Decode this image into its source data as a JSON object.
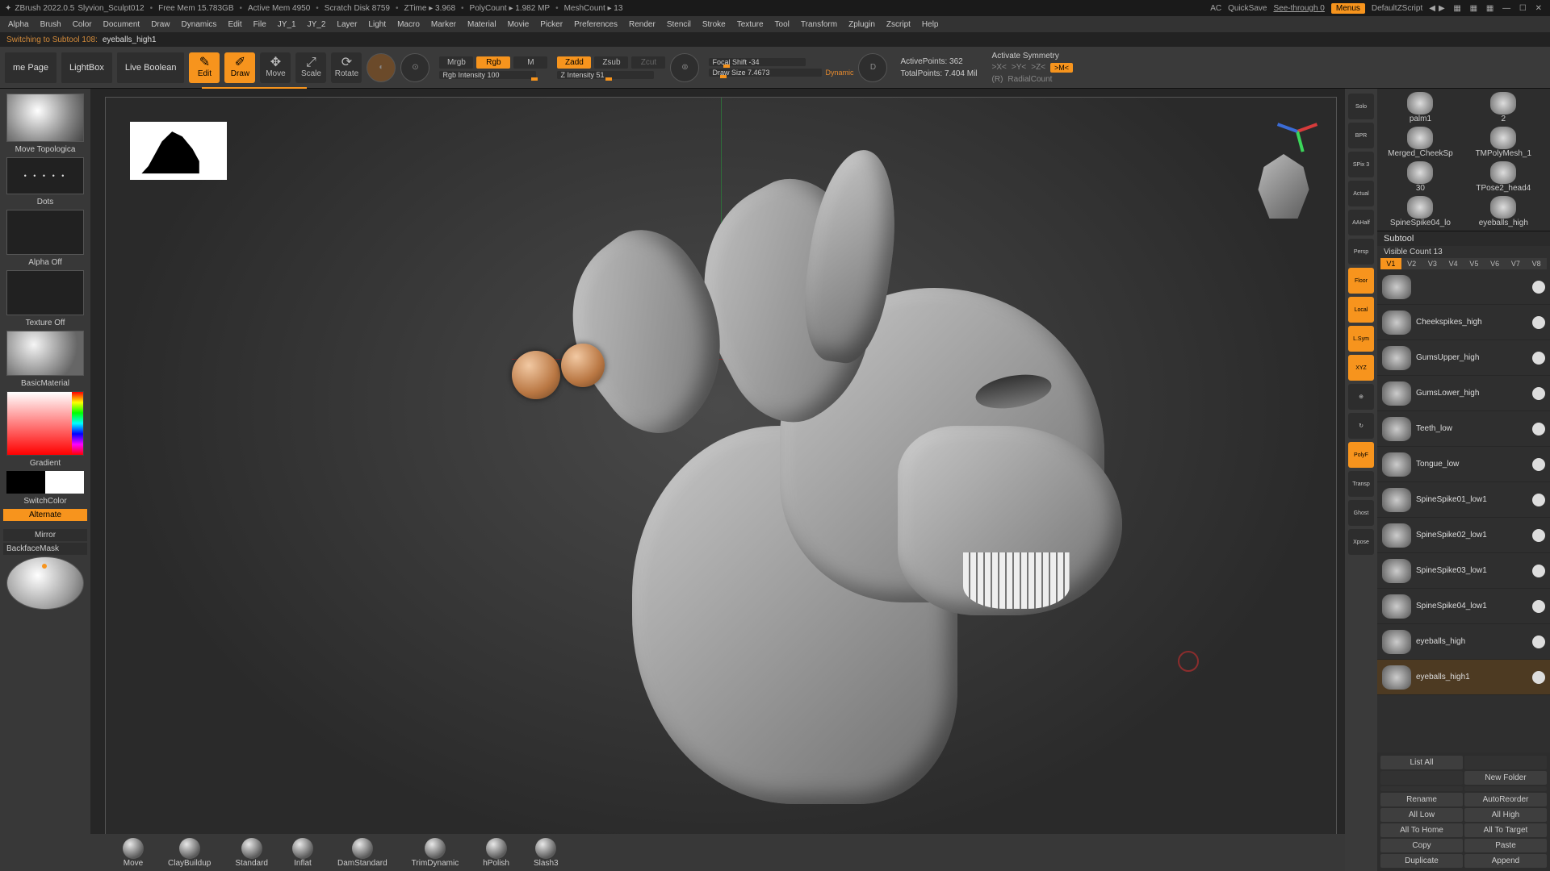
{
  "title": {
    "app": "ZBrush 2022.0.5",
    "project": "Slyvion_Sculpt012",
    "freemem": "Free Mem 15.783GB",
    "activemem": "Active Mem 4950",
    "scratch": "Scratch Disk 8759",
    "ztime": "ZTime ▸ 3.968",
    "polycount": "PolyCount ▸ 1.982 MP",
    "meshcount": "MeshCount ▸ 13",
    "ac": "AC",
    "quicksave": "QuickSave",
    "seethrough": "See-through  0",
    "menus": "Menus",
    "defaultz": "DefaultZScript"
  },
  "menubar": [
    "Alpha",
    "Brush",
    "Color",
    "Document",
    "Draw",
    "Dynamics",
    "Edit",
    "File",
    "JY_1",
    "JY_2",
    "Layer",
    "Light",
    "Macro",
    "Marker",
    "Material",
    "Movie",
    "Picker",
    "Preferences",
    "Render",
    "Stencil",
    "Stroke",
    "Texture",
    "Tool",
    "Transform",
    "Zplugin",
    "Zscript",
    "Help"
  ],
  "status": {
    "line": "Switching to Subtool 108:",
    "subtool": "eyeballs_high1"
  },
  "toolbar": {
    "home": "me Page",
    "lightbox": "LightBox",
    "liveboolean": "Live Boolean",
    "edit": "Edit",
    "draw": "Draw",
    "move": "Move",
    "scale": "Scale",
    "rotate": "Rotate",
    "mrgb": "Mrgb",
    "rgb": "Rgb",
    "m": "M",
    "rgbint": "Rgb Intensity 100",
    "zadd": "Zadd",
    "zsub": "Zsub",
    "zcut": "Zcut",
    "zint": "Z Intensity 51",
    "sculptris": "⊙",
    "focal": "Focal Shift -34",
    "drawsize": "Draw Size 7.4673",
    "dynamic": "Dynamic",
    "dcirc": "D",
    "activepts": "ActivePoints: 362",
    "totalpts": "TotalPoints: 7.404 Mil",
    "activesym": "Activate Symmetry",
    "symX": ">X<",
    "symY": ">Y<",
    "symZ": ">Z<",
    "symM": ">M<",
    "radial": "(R)",
    "radialcount": "RadialCount"
  },
  "left": {
    "brush": "Move Topologica",
    "dots": "Dots",
    "alphaoff": "Alpha Off",
    "textureoff": "Texture Off",
    "material": "BasicMaterial",
    "gradient": "Gradient",
    "switchcolor": "SwitchColor",
    "alternate": "Alternate",
    "mirror": "Mirror",
    "backface": "BackfaceMask"
  },
  "dock": [
    "Solo",
    "BPR",
    "SPix 3",
    "Actual",
    "AAHalf",
    "Persp",
    "Floor",
    "Local",
    "L.Sym",
    "XYZ",
    "⊕",
    "↻",
    "PolyF",
    "Transp",
    "Ghost",
    "Xpose"
  ],
  "dock_on": [
    6,
    7,
    8,
    9,
    12
  ],
  "tool_thumbs": [
    {
      "name": "palm1"
    },
    {
      "name": "2"
    },
    {
      "name": "Merged_CheekSp"
    },
    {
      "name": "TMPolyMesh_1"
    },
    {
      "name": "30"
    },
    {
      "name": "TPose2_head4"
    },
    {
      "name": "SpineSpike04_lo"
    },
    {
      "name": "eyeballs_high"
    }
  ],
  "subtool": {
    "head": "Subtool",
    "viscount": "Visible Count 13",
    "vtabs": [
      "V1",
      "V2",
      "V3",
      "V4",
      "V5",
      "V6",
      "V7",
      "V8"
    ],
    "items": [
      {
        "name": ""
      },
      {
        "name": "Cheekspikes_high"
      },
      {
        "name": "GumsUpper_high"
      },
      {
        "name": "GumsLower_high"
      },
      {
        "name": "Teeth_low"
      },
      {
        "name": "Tongue_low"
      },
      {
        "name": "SpineSpike01_low1"
      },
      {
        "name": "SpineSpike02_low1"
      },
      {
        "name": "SpineSpike03_low1"
      },
      {
        "name": "SpineSpike04_low1"
      },
      {
        "name": "eyeballs_high"
      },
      {
        "name": "eyeballs_high1"
      }
    ],
    "selected": 11,
    "actions": [
      "List All",
      "",
      "",
      "New Folder",
      "",
      "",
      "Rename",
      "AutoReorder",
      "All Low",
      "All High",
      "All To Home",
      "All To Target",
      "Copy",
      "Paste",
      "Duplicate",
      "Append"
    ]
  },
  "shelf": [
    "Move",
    "ClayBuildup",
    "Standard",
    "Inflat",
    "DamStandard",
    "TrimDynamic",
    "hPolish",
    "Slash3"
  ]
}
